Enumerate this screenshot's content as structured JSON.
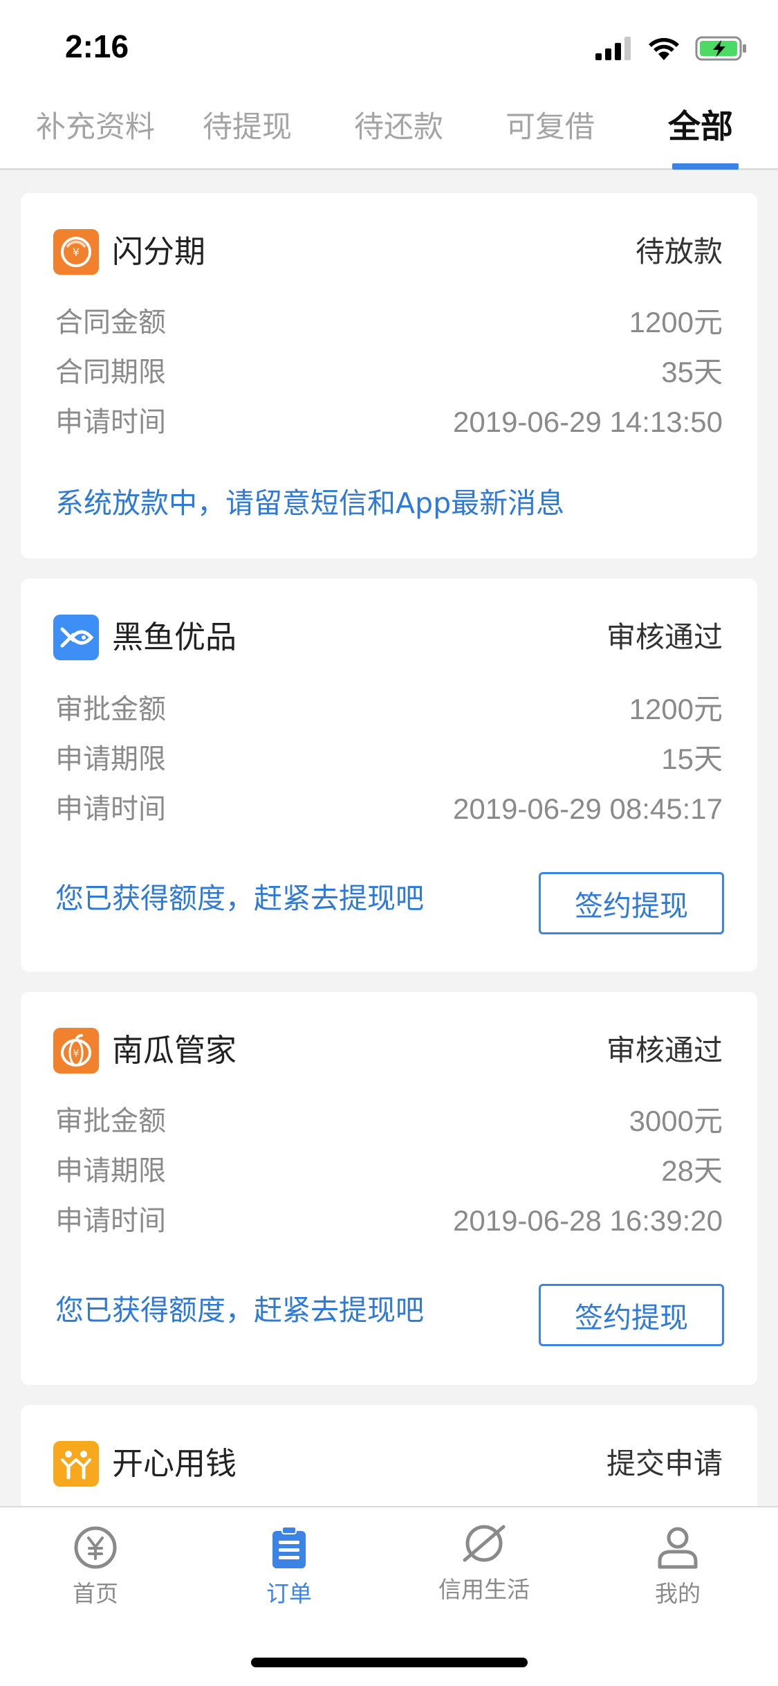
{
  "status_bar": {
    "time": "2:16"
  },
  "tabs": [
    {
      "label": "补充资料",
      "active": false
    },
    {
      "label": "待提现",
      "active": false
    },
    {
      "label": "待还款",
      "active": false
    },
    {
      "label": "可复借",
      "active": false
    },
    {
      "label": "全部",
      "active": true
    }
  ],
  "orders": [
    {
      "brand": "闪分期",
      "status": "待放款",
      "icon": "shanfenqi-logo-icon",
      "icon_color": "#f2812e",
      "rows": [
        {
          "label": "合同金额",
          "value": "1200元"
        },
        {
          "label": "合同期限",
          "value": "35天"
        },
        {
          "label": "申请时间",
          "value": "2019-06-29 14:13:50"
        }
      ],
      "note": "系统放款中，请留意短信和App最新消息"
    },
    {
      "brand": "黑鱼优品",
      "status": "审核通过",
      "icon": "heiyu-logo-icon",
      "icon_color": "#3d8ef5",
      "rows": [
        {
          "label": "审批金额",
          "value": "1200元"
        },
        {
          "label": "申请期限",
          "value": "15天"
        },
        {
          "label": "申请时间",
          "value": "2019-06-29 08:45:17"
        }
      ],
      "note": "您已获得额度，赶紧去提现吧",
      "button": "签约提现"
    },
    {
      "brand": "南瓜管家",
      "status": "审核通过",
      "icon": "pumpkin-logo-icon",
      "icon_color": "#f2812e",
      "rows": [
        {
          "label": "审批金额",
          "value": "3000元"
        },
        {
          "label": "申请期限",
          "value": "28天"
        },
        {
          "label": "申请时间",
          "value": "2019-06-28 16:39:20"
        }
      ],
      "note": "您已获得额度，赶紧去提现吧",
      "button": "签约提现"
    },
    {
      "brand": "开心用钱",
      "status": "提交申请",
      "icon": "kaixin-logo-icon",
      "icon_color": "#f7a81c"
    }
  ],
  "bottom_nav": [
    {
      "label": "首页",
      "icon": "yen-coin-icon",
      "active": false
    },
    {
      "label": "订单",
      "icon": "clipboard-list-icon",
      "active": true
    },
    {
      "label": "信用生活",
      "icon": "planet-icon",
      "active": false
    },
    {
      "label": "我的",
      "icon": "person-icon",
      "active": false
    }
  ],
  "colors": {
    "accent": "#3b84e6",
    "note_blue": "#2f7ad6"
  }
}
